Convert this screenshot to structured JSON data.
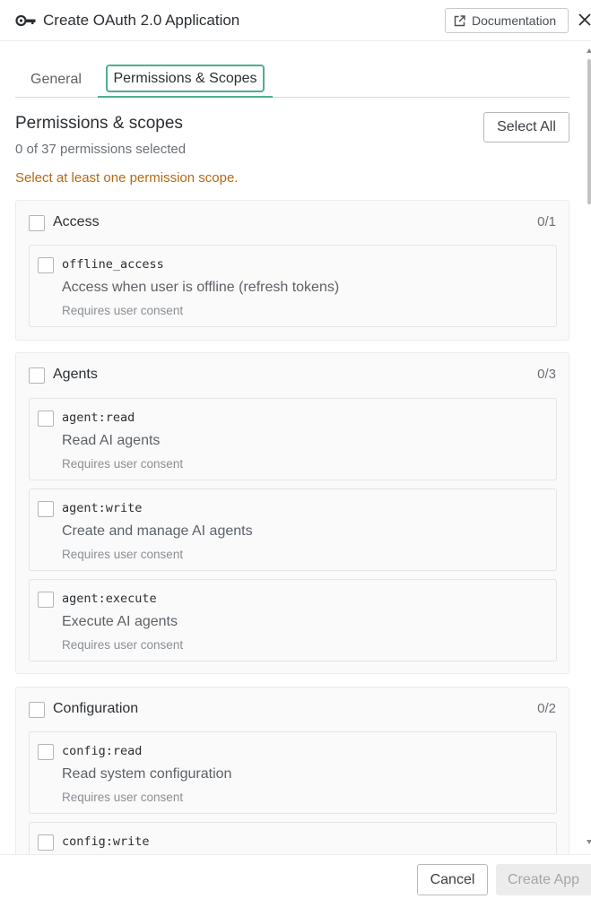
{
  "header": {
    "title": "Create OAuth 2.0 Application",
    "documentation_label": "Documentation",
    "close_icon": "close-icon"
  },
  "tabs": [
    {
      "label": "General",
      "active": false
    },
    {
      "label": "Permissions & Scopes",
      "active": true
    }
  ],
  "permissions": {
    "title": "Permissions & scopes",
    "selected_summary": "0 of 37 permissions selected",
    "warning": "Select at least one permission scope.",
    "select_all_label": "Select All"
  },
  "groups": [
    {
      "name": "Access",
      "count": "0/1",
      "items": [
        {
          "scope": "offline_access",
          "description": "Access when user is offline (refresh tokens)",
          "consent": "Requires user consent"
        }
      ]
    },
    {
      "name": "Agents",
      "count": "0/3",
      "items": [
        {
          "scope": "agent:read",
          "description": "Read AI agents",
          "consent": "Requires user consent"
        },
        {
          "scope": "agent:write",
          "description": "Create and manage AI agents",
          "consent": "Requires user consent"
        },
        {
          "scope": "agent:execute",
          "description": "Execute AI agents",
          "consent": "Requires user consent"
        }
      ]
    },
    {
      "name": "Configuration",
      "count": "0/2",
      "items": [
        {
          "scope": "config:read",
          "description": "Read system configuration",
          "consent": "Requires user consent"
        },
        {
          "scope": "config:write",
          "description": "",
          "consent": ""
        }
      ]
    }
  ],
  "footer": {
    "cancel_label": "Cancel",
    "create_label": "Create App"
  },
  "colors": {
    "accent": "#4caf8e",
    "warning": "#b66a12",
    "disabled_bg": "#ececec"
  }
}
